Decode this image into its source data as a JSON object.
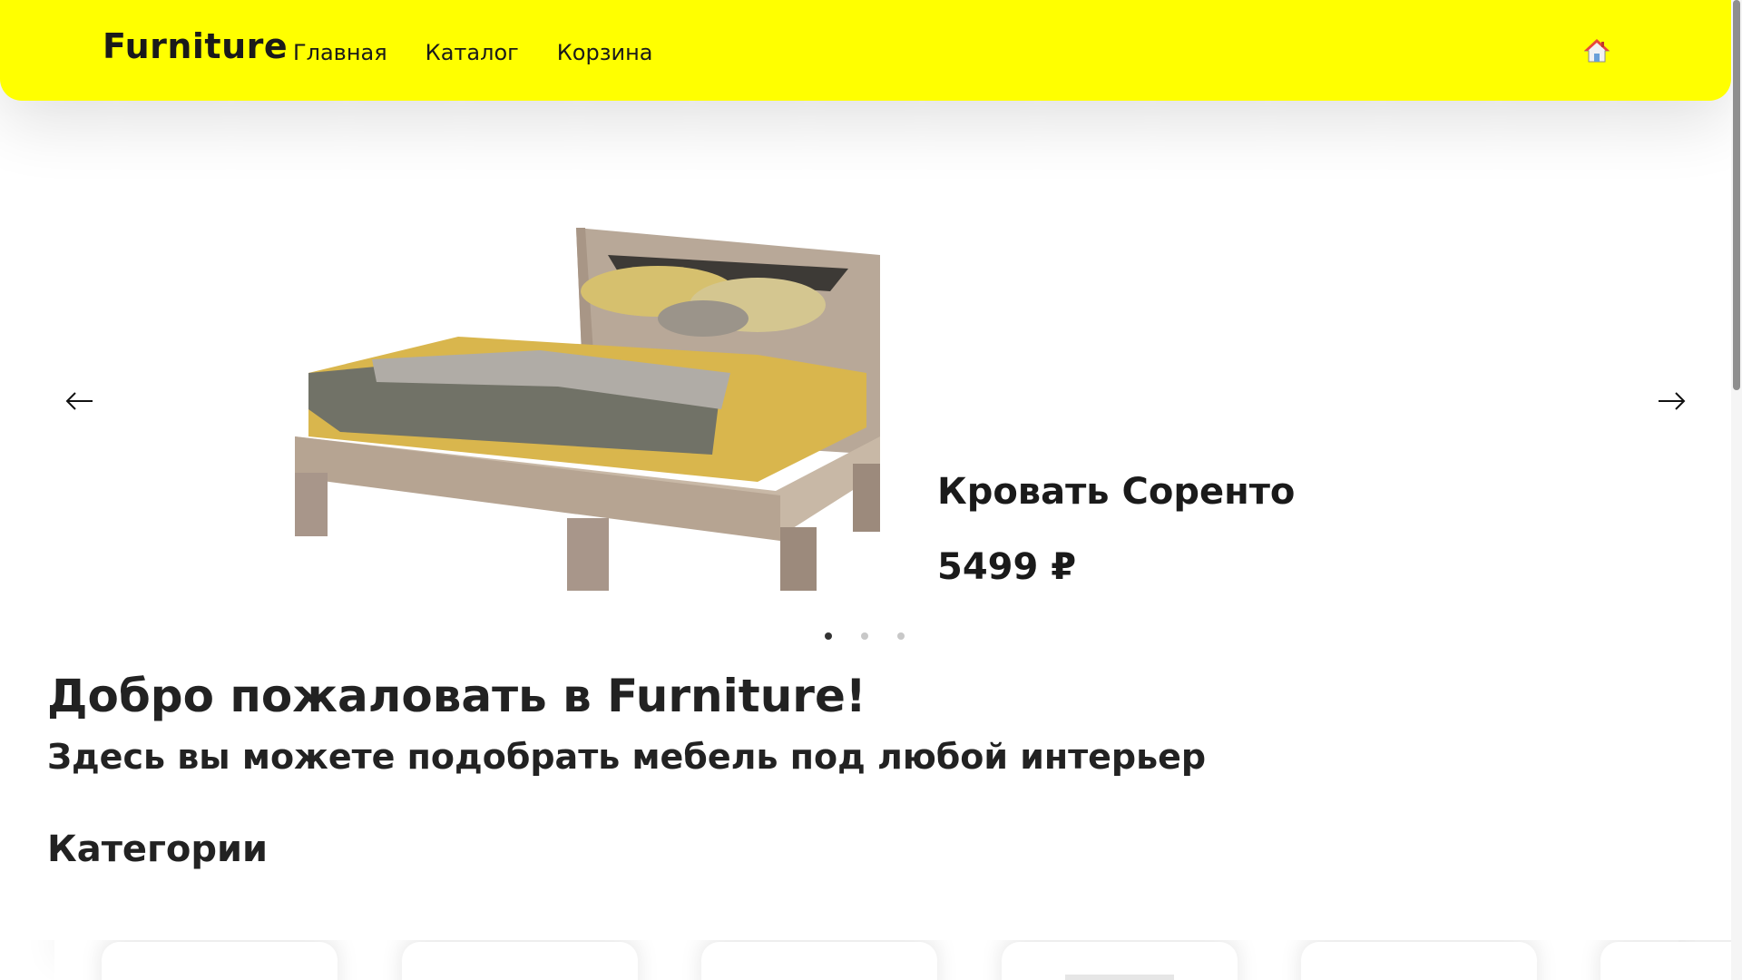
{
  "header": {
    "brand": "Furniture",
    "nav": [
      {
        "label": "Главная"
      },
      {
        "label": "Каталог"
      },
      {
        "label": "Корзина"
      }
    ],
    "home_icon": "home-icon"
  },
  "carousel": {
    "slides": [
      {
        "title": "Кровать Соренто",
        "price": "5499 ₽",
        "image": "bed-image"
      }
    ],
    "active_index": 0,
    "dot_count": 3,
    "prev_icon": "arrow-left-icon",
    "next_icon": "arrow-right-icon"
  },
  "welcome": {
    "title": "Добро пожаловать в Furniture!",
    "subtitle": "Здесь вы можете подобрать мебель под любой интерьер"
  },
  "categories": {
    "title": "Категории",
    "card_count": 6
  },
  "colors": {
    "header_bg": "#ffff00",
    "text": "#1a1a1a"
  }
}
